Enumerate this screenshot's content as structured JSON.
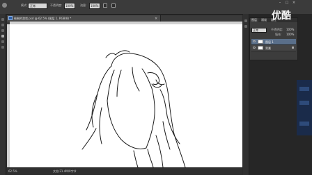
{
  "options_bar": {
    "mode_label": "模式:",
    "mode_value": "正常",
    "opacity_label": "不透明度:",
    "opacity_value": "100%",
    "flow_label": "流量:",
    "flow_value": "100%"
  },
  "document": {
    "tab_title": "绘制的游戏.psd @ 62.5% (图层 1, RGB/8) *",
    "zoom": "62.5%",
    "doc_info": "文档:21.4M/0字节"
  },
  "layers_panel": {
    "tabs": [
      "图层",
      "通道",
      "路径"
    ],
    "blend_mode": "正常",
    "opacity_label": "不透明度:",
    "opacity_value": "100%",
    "fill_label": "填充:",
    "fill_value": "100%",
    "layers": [
      {
        "name": "图层 1"
      },
      {
        "name": "背景"
      }
    ]
  },
  "watermark": {
    "logo_text": "优酷"
  },
  "colors": {
    "workspace": "#2b2b2b",
    "panel": "#3c3c3c",
    "canvas": "#ffffff",
    "accent": "#2b5ea8"
  }
}
